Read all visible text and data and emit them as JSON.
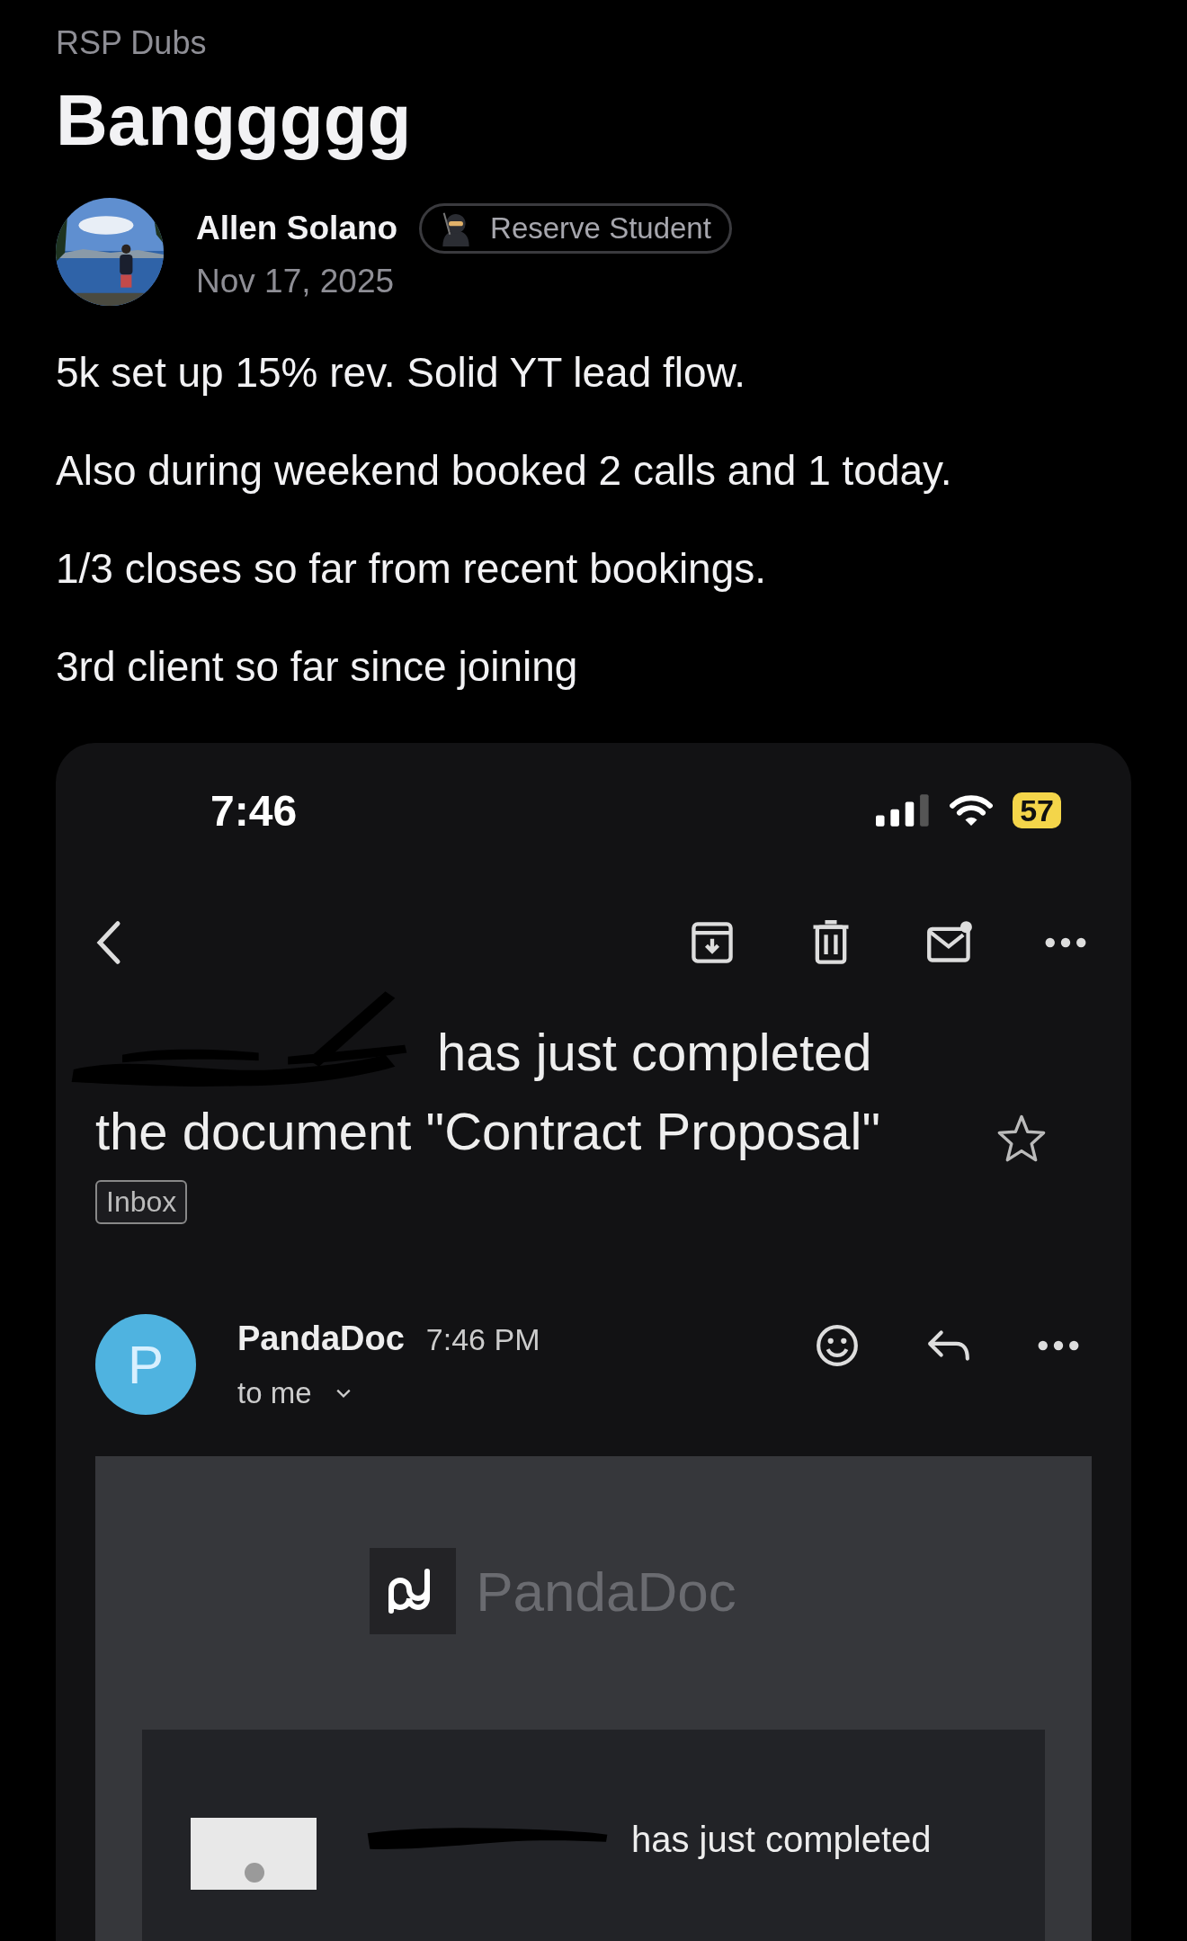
{
  "post": {
    "community": "RSP Dubs",
    "title": "Banggggg",
    "author": {
      "name": "Allen Solano",
      "badge": "Reserve Student",
      "date": "Nov 17, 2025"
    },
    "paragraphs": [
      "5k set up 15% rev. Solid YT lead flow.",
      "Also during weekend booked 2 calls and 1 today.",
      "1/3 closes so far from recent bookings.",
      "3rd client so far since joining"
    ]
  },
  "screenshot": {
    "status_bar": {
      "time": "7:46",
      "battery": "57"
    },
    "subject": [
      "has just completed",
      "the document \"Contract Proposal\""
    ],
    "starred": false,
    "label": "Inbox",
    "sender": {
      "initial": "P",
      "name": "PandaDoc",
      "time": "7:46 PM",
      "recipient": "to me"
    },
    "email": {
      "brand": "PandaDoc",
      "message": "has just completed"
    }
  }
}
